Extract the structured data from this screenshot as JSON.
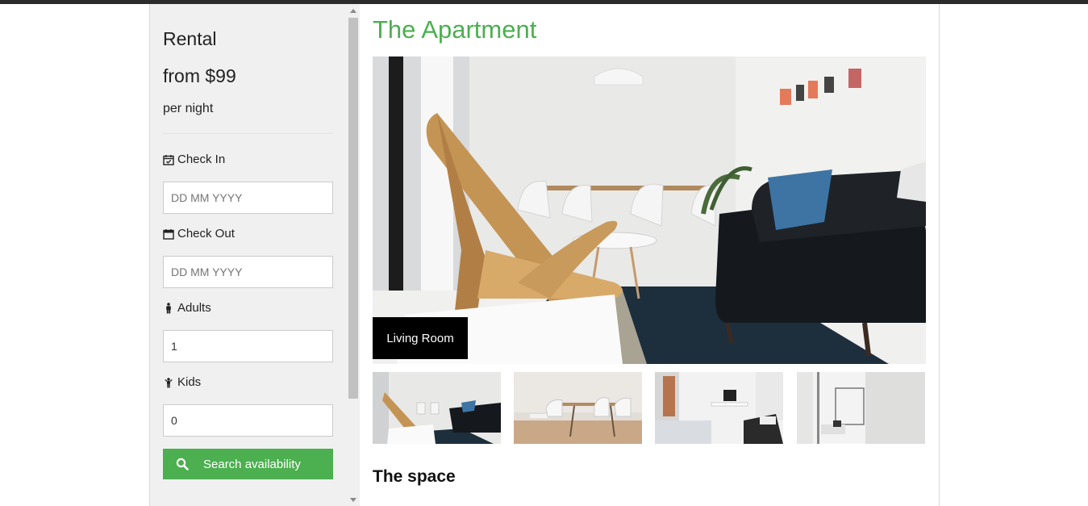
{
  "sidebar": {
    "rental_label": "Rental",
    "price_text": "from $99",
    "per_night": "per night",
    "check_in": {
      "label": "Check In",
      "icon": "calendar-check-icon",
      "placeholder": "DD MM YYYY"
    },
    "check_out": {
      "label": "Check Out",
      "icon": "calendar-icon",
      "placeholder": "DD MM YYYY"
    },
    "adults": {
      "label": "Adults",
      "icon": "male-icon",
      "value": "1"
    },
    "kids": {
      "label": "Kids",
      "icon": "child-icon",
      "value": "0"
    },
    "search_button": {
      "label": "Search availability",
      "icon": "search-icon"
    }
  },
  "main": {
    "title": "The Apartment",
    "hero_caption": "Living Room",
    "thumbnails": [
      {
        "name": "thumbnail-living-room"
      },
      {
        "name": "thumbnail-dining"
      },
      {
        "name": "thumbnail-bedroom"
      },
      {
        "name": "thumbnail-window-room"
      }
    ],
    "section_title": "The space"
  },
  "colors": {
    "accent": "#4caf50",
    "sidebar_bg": "#f0f0f0",
    "topbar": "#2b2b2b"
  }
}
